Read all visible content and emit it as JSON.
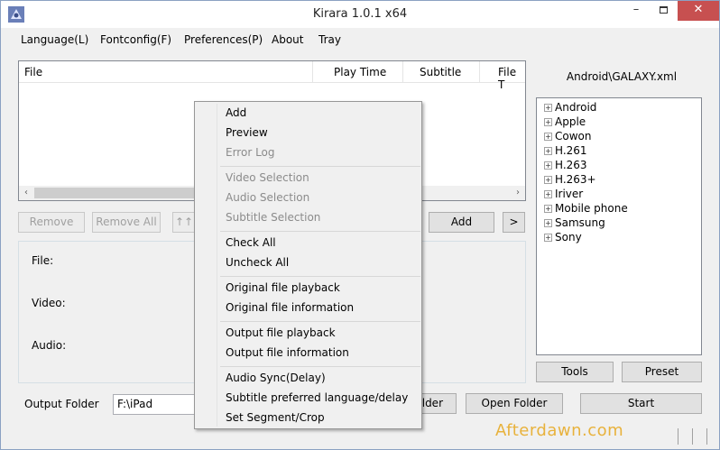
{
  "window": {
    "title": "Kirara 1.0.1 x64",
    "app_icon": "kirara-app-icon",
    "controls": {
      "minimize": "–",
      "maximize": "□",
      "close": "✕"
    }
  },
  "menubar": {
    "items": [
      "Language(L)",
      "Fontconfig(F)",
      "Preferences(P)",
      "About",
      "Tray"
    ]
  },
  "file_list": {
    "columns": [
      "File",
      "Play Time",
      "Subtitle",
      "File T"
    ],
    "scroll_left": "‹",
    "scroll_right": "›"
  },
  "list_buttons": {
    "remove": "Remove",
    "remove_all": "Remove All",
    "move": "↑↑",
    "add": "Add",
    "more": ">"
  },
  "info": {
    "file_label": "File:",
    "video_label": "Video:",
    "audio_label": "Audio:"
  },
  "profile": {
    "path": "Android\\GALAXY.xml",
    "tree_items": [
      "Android",
      "Apple",
      "Cowon",
      "H.261",
      "H.263",
      "H.263+",
      "Iriver",
      "Mobile phone",
      "Samsung",
      "Sony"
    ],
    "expander": "+",
    "tools": "Tools",
    "preset": "Preset"
  },
  "output": {
    "label": "Output Folder",
    "value": "F:\\iPad",
    "folder_btn": "older",
    "open_folder": "Open Folder",
    "start": "Start"
  },
  "watermark": "Afterdawn.com",
  "context_menu": {
    "items": [
      {
        "label": "Add",
        "enabled": true
      },
      {
        "label": "Preview",
        "enabled": true
      },
      {
        "label": "Error Log",
        "enabled": false
      },
      {
        "label": "Video Selection",
        "enabled": false
      },
      {
        "label": "Audio Selection",
        "enabled": false
      },
      {
        "label": "Subtitle Selection",
        "enabled": false
      },
      {
        "label": "Check All",
        "enabled": true
      },
      {
        "label": "Uncheck All",
        "enabled": true
      },
      {
        "label": "Original file playback",
        "enabled": true
      },
      {
        "label": "Original file information",
        "enabled": true
      },
      {
        "label": "Output file playback",
        "enabled": true
      },
      {
        "label": "Output file information",
        "enabled": true
      },
      {
        "label": "Audio Sync(Delay)",
        "enabled": true
      },
      {
        "label": "Subtitle preferred language/delay",
        "enabled": true
      },
      {
        "label": "Set Segment/Crop",
        "enabled": true
      }
    ]
  }
}
